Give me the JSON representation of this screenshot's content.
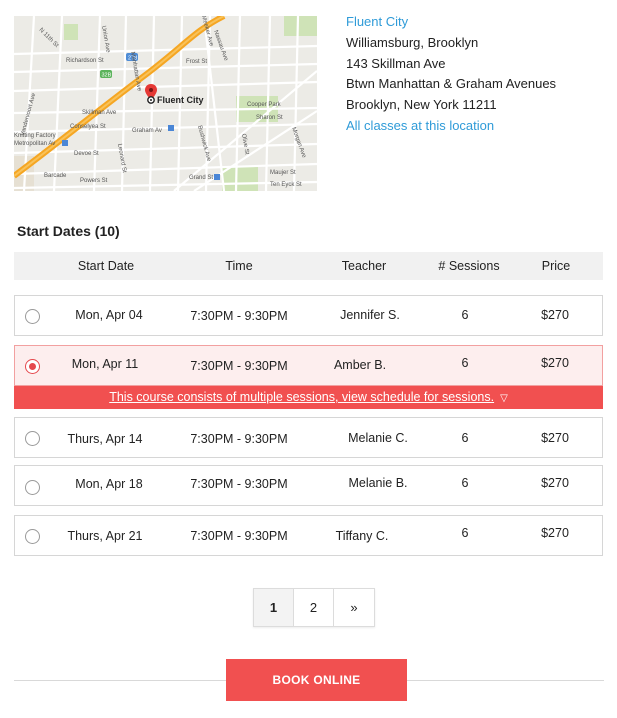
{
  "map": {
    "pin_label": "Fluent City",
    "streets": [
      "Richardson St",
      "Frost St",
      "Skillman Ave",
      "Conselyea St",
      "Devoe St",
      "Powers St",
      "Barcade",
      "Graham Av",
      "Grand St",
      "Cooper Park",
      "Sharon St",
      "Maujer St",
      "Ten Eyck St",
      "Manhattan Ave",
      "Leonard St",
      "Bushwick Ave",
      "Olive St",
      "Morgan Ave",
      "Vandervoort Ave",
      "Union Ave",
      "Meeker Ave",
      "Knitting Factory",
      "Metropolitan Av",
      "N 11th St",
      "Nassau Ave"
    ],
    "highway_labels": [
      "278",
      "32B"
    ]
  },
  "location": {
    "name": "Fluent City",
    "neighborhood": "Williamsburg, Brooklyn",
    "address": "143 Skillman Ave",
    "cross_streets": "Btwn Manhattan & Graham Avenues",
    "city": "Brooklyn, New York 11211",
    "all_classes_link": "All classes at this location"
  },
  "dates": {
    "title": "Start Dates (10)",
    "headers": [
      "Start Date",
      "Time",
      "Teacher",
      "# Sessions",
      "Price"
    ],
    "rows": [
      {
        "date": "Mon, Apr 04",
        "time": "7:30PM - 9:30PM",
        "teacher": "Jennifer S.",
        "sessions": "6",
        "price": "$270",
        "selected": false
      },
      {
        "date": "Mon, Apr 11",
        "time": "7:30PM - 9:30PM",
        "teacher": "Amber B.",
        "sessions": "6",
        "price": "$270",
        "selected": true
      },
      {
        "date": "Thurs, Apr 14",
        "time": "7:30PM - 9:30PM",
        "teacher": "Melanie C.",
        "sessions": "6",
        "price": "$270",
        "selected": false
      },
      {
        "date": "Mon, Apr 18",
        "time": "7:30PM - 9:30PM",
        "teacher": "Melanie B.",
        "sessions": "6",
        "price": "$270",
        "selected": false
      },
      {
        "date": "Thurs, Apr 21",
        "time": "7:30PM - 9:30PM",
        "teacher": "Tiffany C.",
        "sessions": "6",
        "price": "$270",
        "selected": false
      }
    ],
    "sessions_notice": "This course consists of multiple sessions, view schedule for sessions.",
    "sessions_icon": "chevron-down-icon"
  },
  "pagination": {
    "pages": [
      "1",
      "2",
      "»"
    ],
    "current": "1"
  },
  "book_button": "BOOK ONLINE",
  "colors": {
    "accent_red": "#f15050",
    "link_blue": "#2f9bd8",
    "selected_row_bg": "#fdeeee"
  }
}
